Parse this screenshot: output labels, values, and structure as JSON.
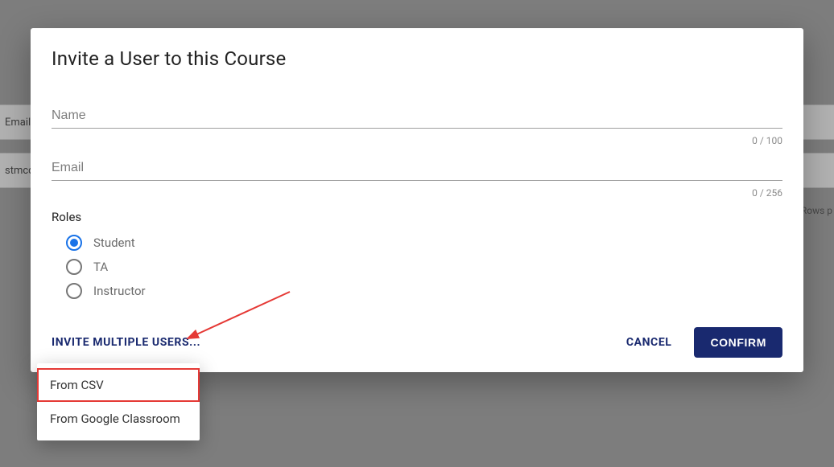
{
  "dialog": {
    "title": "Invite a User to this Course",
    "name_placeholder": "Name",
    "name_value": "",
    "name_counter": "0 / 100",
    "email_placeholder": "Email",
    "email_value": "",
    "email_counter": "0 / 256",
    "roles_label": "Roles",
    "roles": {
      "student": "Student",
      "ta": "TA",
      "instructor": "Instructor"
    },
    "invite_multiple": "INVITE MULTIPLE USERS...",
    "cancel": "CANCEL",
    "confirm": "CONFIRM"
  },
  "menu": {
    "from_csv": "From CSV",
    "from_gc": "From Google Classroom"
  },
  "background": {
    "col_email": "Email",
    "row_stmcd": "stmcd",
    "rows_per": "Rows p"
  },
  "annotation": {
    "arrow_color": "#e53935"
  }
}
